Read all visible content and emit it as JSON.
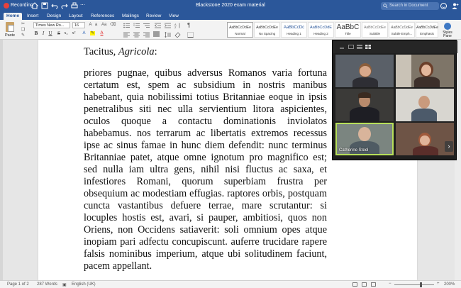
{
  "app": {
    "recording_label": "Recording",
    "doc_title": "Blackstone 2020 exam material",
    "search_placeholder": "Search in Document"
  },
  "tabs": [
    "Home",
    "Insert",
    "Design",
    "Layout",
    "References",
    "Mailings",
    "Review",
    "View"
  ],
  "ribbon": {
    "paste_label": "Paste",
    "font_name": "Times New Ro...",
    "font_size": "16",
    "format_buttons": [
      "B",
      "I",
      "U",
      "S",
      "x₂",
      "x²"
    ],
    "styles": [
      {
        "sample": "AaBbCcDdEe",
        "label": "Normal"
      },
      {
        "sample": "AaBbCcDdEe",
        "label": "No Spacing"
      },
      {
        "sample": "AaBbCcDc",
        "label": "Heading 1"
      },
      {
        "sample": "AaBbCcDdE",
        "label": "Heading 2"
      },
      {
        "sample": "AaBbC",
        "label": "Title"
      },
      {
        "sample": "AaBbCcDdEe",
        "label": "Subtitle"
      },
      {
        "sample": "AaBbCcDdEe",
        "label": "Subtle Emph..."
      },
      {
        "sample": "AaBbCcDdEe",
        "label": "Emphasis"
      }
    ],
    "styles_pane_label": "Styles Pane"
  },
  "document": {
    "heading_plain": "Tacitus, ",
    "heading_italic": "Agricola",
    "heading_suffix": ":",
    "body_segments": [
      {
        "t": "priores pugnae, quibus adversus Romanos varia fortuna certatum est, spem ac subsidium in nostris manibus habebant, quia nobilissimi totius Britanniae eoque in ipsis penetralibus siti nec ulla servientium litora aspicientes, oculos quoque a contactu dominationis inviolatos habebamus. nos terrarum ac libertatis extremos recessus ipse ac sinus famae in hunc diem defendit: nunc terminus Britanniae patet, atque omne ignotum pro magnifico est; sed nulla iam ultra gens, nihil nisi fluctus ac saxa, et infestiores Romani, quorum superbiam frustra per obsequium ac modestiam effugias. raptores orbis, postquam cuncta vastantibus defuere terrae, mare scrutantur: si locuples hostis est, avari, si pauper, ambitiosi, quos non Oriens, non Occidens satiaverit: soli omnium opes atque inopiam pari adfectu concupiscunt. auferre trucidare rapere falsis nominibus imperium, atque ubi solitudinem faciunt, pacem appellant."
      }
    ]
  },
  "video_call": {
    "active_speaker": "Catherine Steel"
  },
  "status": {
    "page": "Page 1 of 2",
    "words": "287 Words",
    "language": "English (UK)",
    "zoom": "200%"
  }
}
